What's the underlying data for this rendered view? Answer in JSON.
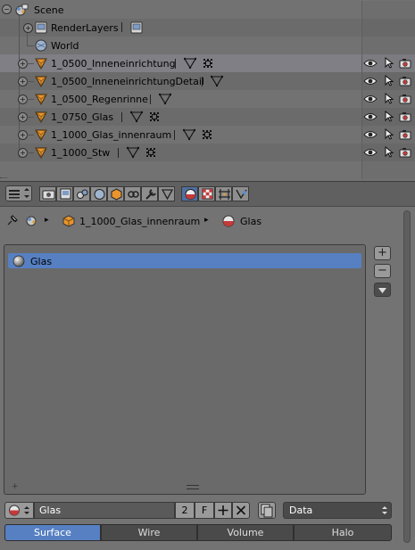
{
  "outliner": {
    "rows": [
      {
        "label": "Scene",
        "kind": "scene"
      },
      {
        "label": "RenderLayers",
        "kind": "renderlayers"
      },
      {
        "label": "World",
        "kind": "world"
      },
      {
        "label": "1_0500_Inneneinrichtung",
        "kind": "object"
      },
      {
        "label": "1_0500_InneneinrichtungDetail",
        "kind": "object"
      },
      {
        "label": "1_0500_Regenrinne",
        "kind": "object"
      },
      {
        "label": "1_0750_Glas",
        "kind": "object"
      },
      {
        "label": "1_1000_Glas_innenraum",
        "kind": "object",
        "selected": true
      },
      {
        "label": "1_1000_Stw",
        "kind": "object"
      }
    ]
  },
  "properties": {
    "context": {
      "object": "1_1000_Glas_innenraum",
      "material": "Glas"
    },
    "material_slots": [
      {
        "name": "Glas"
      }
    ],
    "datablock": {
      "name": "Glas",
      "users": "2",
      "fake_user": "F",
      "link": "Data"
    },
    "preview_tabs": [
      "Surface",
      "Wire",
      "Volume",
      "Halo"
    ],
    "active_tab": "Surface"
  },
  "colors": {
    "selection": "#5680c2",
    "object_icon": "#e8952e"
  }
}
